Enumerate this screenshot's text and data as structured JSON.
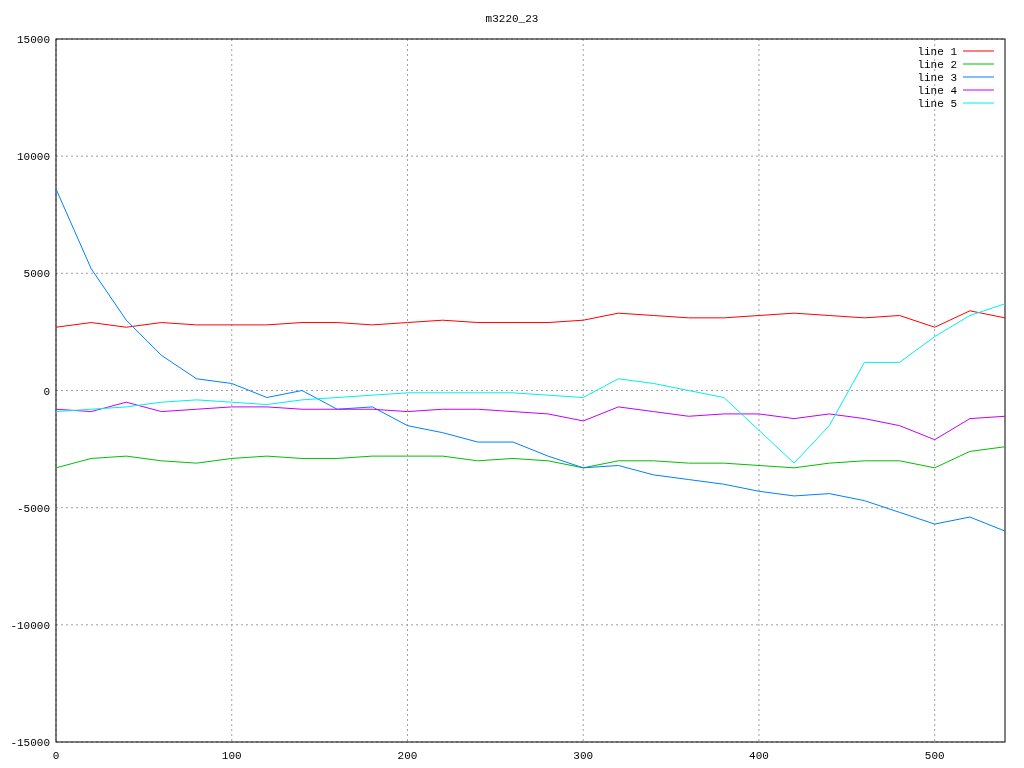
{
  "chart_data": {
    "type": "line",
    "title": "m3220_23",
    "x": [
      0,
      20,
      40,
      60,
      80,
      100,
      120,
      140,
      160,
      180,
      200,
      220,
      240,
      260,
      280,
      300,
      320,
      340,
      360,
      380,
      400,
      420,
      440,
      460,
      480,
      500,
      520,
      540
    ],
    "series": [
      {
        "name": "line 1",
        "color": "#ff0000",
        "values": [
          2700,
          2900,
          2700,
          2900,
          2800,
          2800,
          2800,
          2900,
          2900,
          2800,
          2900,
          3000,
          2900,
          2900,
          2900,
          3000,
          3300,
          3200,
          3100,
          3100,
          3200,
          3300,
          3200,
          3100,
          3200,
          2700,
          3400,
          3100
        ]
      },
      {
        "name": "line 2",
        "color": "#00c000",
        "values": [
          -3300,
          -2900,
          -2800,
          -3000,
          -3100,
          -2900,
          -2800,
          -2900,
          -2900,
          -2800,
          -2800,
          -2800,
          -3000,
          -2900,
          -3000,
          -3300,
          -3000,
          -3000,
          -3100,
          -3100,
          -3200,
          -3300,
          -3100,
          -3000,
          -3000,
          -3300,
          -2600,
          -2400
        ]
      },
      {
        "name": "line 3",
        "color": "#0080ff",
        "values": [
          8600,
          5200,
          3000,
          1500,
          500,
          300,
          -300,
          0,
          -800,
          -700,
          -1500,
          -1800,
          -2200,
          -2200,
          -2800,
          -3300,
          -3200,
          -3600,
          -3800,
          -4000,
          -4300,
          -4500,
          -4400,
          -4700,
          -5200,
          -5700,
          -5400,
          -6000
        ]
      },
      {
        "name": "line 4",
        "color": "#c000ff",
        "values": [
          -800,
          -900,
          -500,
          -900,
          -800,
          -700,
          -700,
          -800,
          -800,
          -800,
          -900,
          -800,
          -800,
          -900,
          -1000,
          -1300,
          -700,
          -900,
          -1100,
          -1000,
          -1000,
          -1200,
          -1000,
          -1200,
          -1500,
          -2100,
          -1200,
          -1100
        ]
      },
      {
        "name": "line 5",
        "color": "#00eeee",
        "values": [
          -900,
          -800,
          -700,
          -500,
          -400,
          -500,
          -600,
          -400,
          -300,
          -200,
          -100,
          -100,
          -100,
          -100,
          -200,
          -300,
          500,
          300,
          0,
          -300,
          -1700,
          -3100,
          -1500,
          1200,
          1200,
          2300,
          3200,
          3700
        ]
      }
    ],
    "xlim": [
      0,
      540
    ],
    "ylim": [
      -15000,
      15000
    ],
    "xticks": [
      0,
      100,
      200,
      300,
      400,
      500
    ],
    "yticks": [
      -15000,
      -10000,
      -5000,
      0,
      5000,
      10000,
      15000
    ],
    "grid": true,
    "legend": true
  }
}
